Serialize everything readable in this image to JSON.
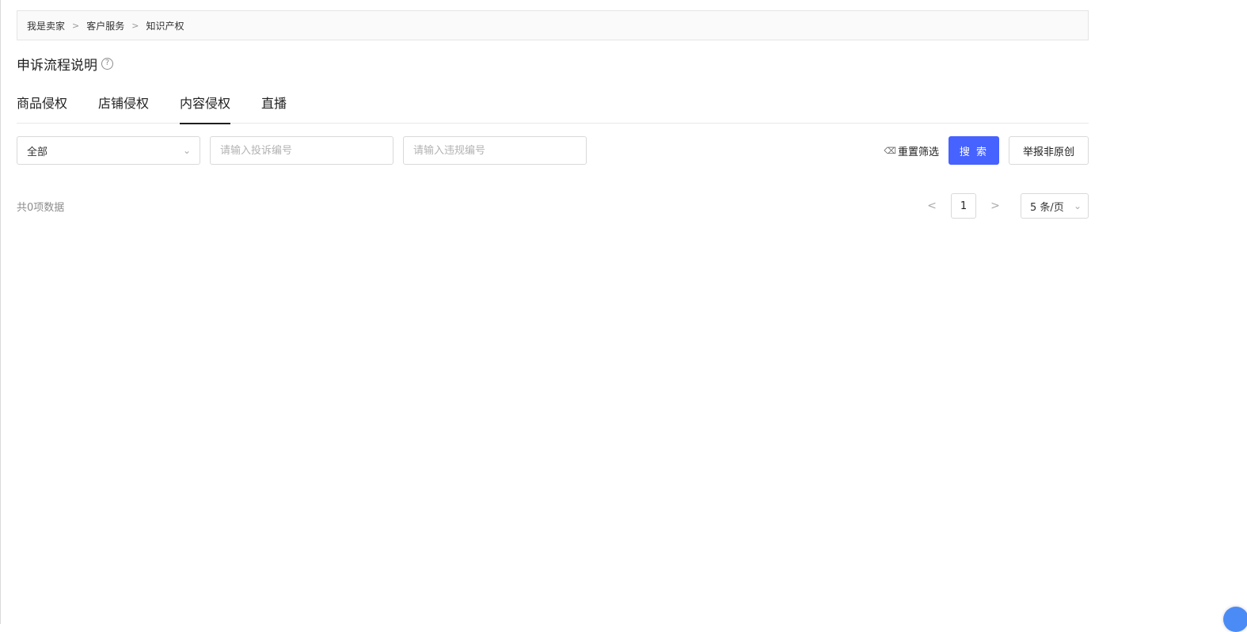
{
  "breadcrumb": {
    "items": [
      "我是卖家",
      "客户服务",
      "知识产权"
    ],
    "separator": ">"
  },
  "title": {
    "text": "申诉流程说明",
    "help_icon": "?"
  },
  "tabs": [
    {
      "label": "商品侵权",
      "active": false
    },
    {
      "label": "店铺侵权",
      "active": false
    },
    {
      "label": "内容侵权",
      "active": true
    },
    {
      "label": "直播",
      "active": false
    }
  ],
  "filters": {
    "status_select": "全部",
    "complaint_no_placeholder": "请输入投诉编号",
    "violation_no_placeholder": "请输入违规编号",
    "reset_label": "重置筛选",
    "search_label": "搜 索",
    "report_label": "举报非原创"
  },
  "pagination": {
    "total_text": "共0项数据",
    "prev": "<",
    "current_page": "1",
    "next": ">",
    "page_size": "5 条/页"
  },
  "colors": {
    "primary": "#4662ff",
    "border": "#d9d9d9"
  }
}
